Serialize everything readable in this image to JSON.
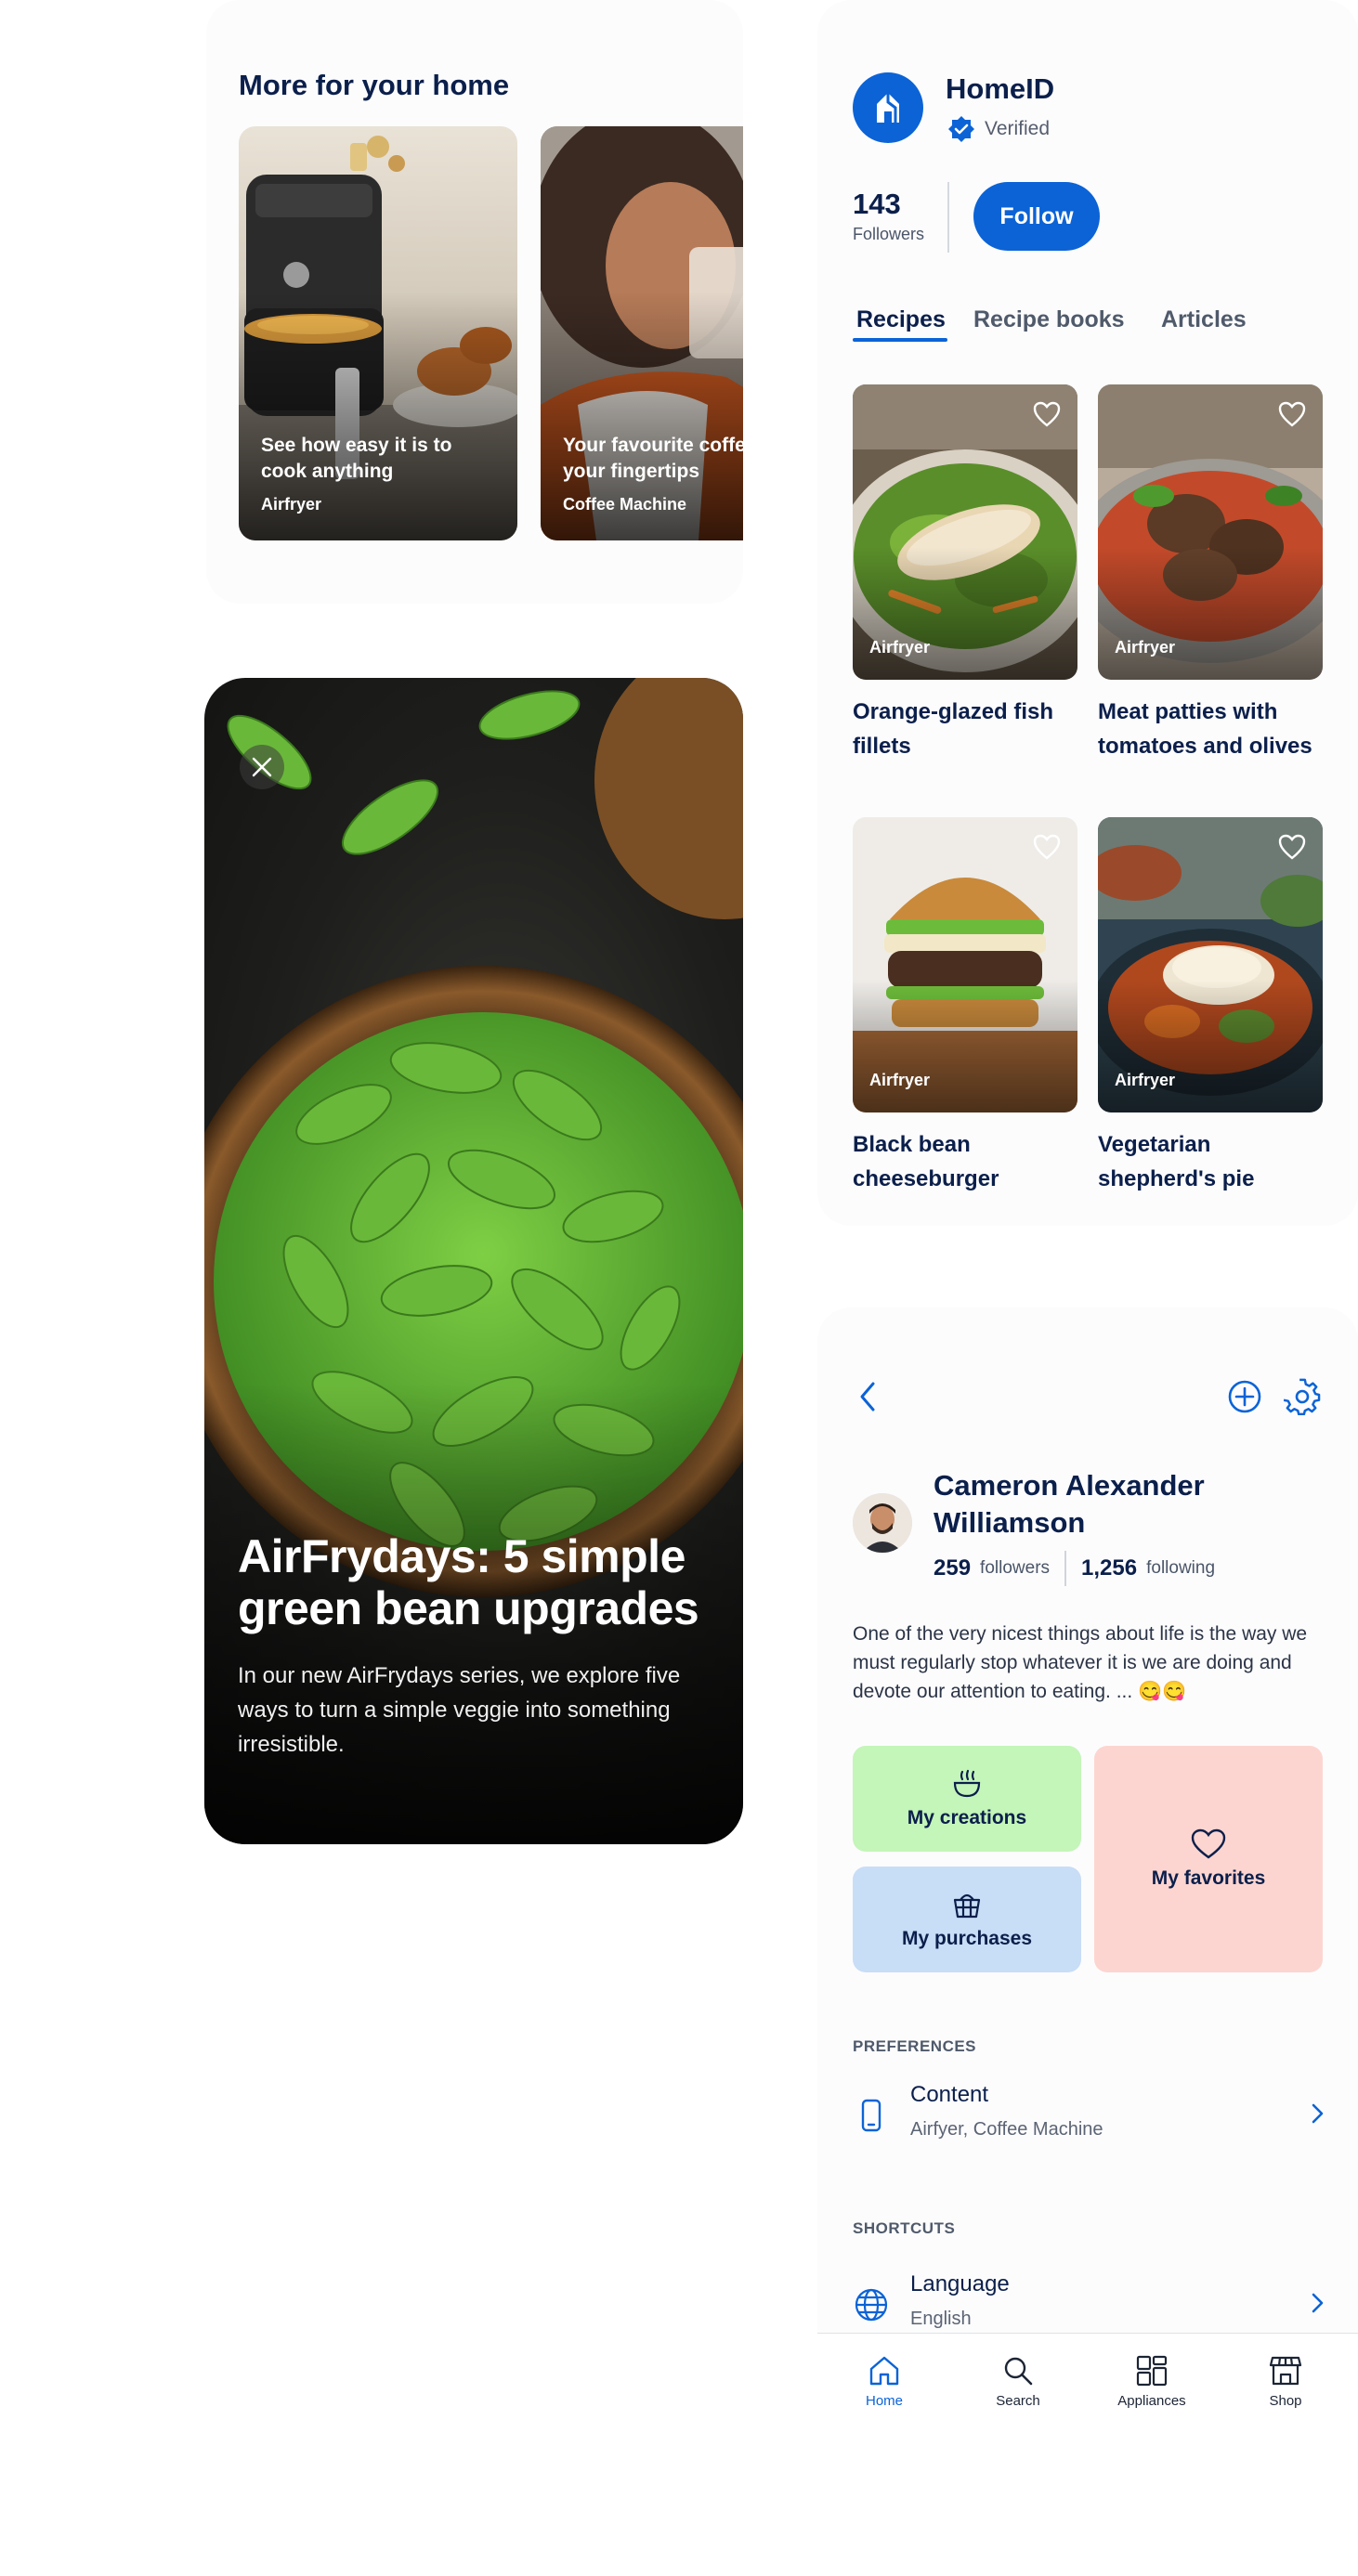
{
  "more_for_home": {
    "title": "More for your home",
    "cards": [
      {
        "title": "See how easy it is to\ncook anything",
        "tag": "Airfryer"
      },
      {
        "title": "Your favourite coffee\nyour fingertips",
        "tag": "Coffee Machine"
      }
    ]
  },
  "article": {
    "title": "AirFrydays: 5 simple green bean upgrades",
    "body": "In our new AirFrydays series, we explore five ways to turn a simple veggie into something irresistible."
  },
  "brand": {
    "name": "HomeID",
    "verified_label": "Verified",
    "followers_count": "143",
    "followers_label": "Followers",
    "follow_label": "Follow",
    "accent": "#0b63d6",
    "tabs": [
      "Recipes",
      "Recipe books",
      "Articles"
    ],
    "recipes": [
      {
        "name": "Orange-glazed fish\nfillets",
        "tag": "Airfryer"
      },
      {
        "name": "Meat patties with\ntomatoes and olives",
        "tag": "Airfryer"
      },
      {
        "name": "Black bean\ncheeseburger",
        "tag": "Airfryer"
      },
      {
        "name": "Vegetarian\nshepherd's pie",
        "tag": "Airfryer"
      }
    ]
  },
  "profile": {
    "name": "Cameron Alexander Williamson",
    "followers_count": "259",
    "followers_label": "followers",
    "following_count": "1,256",
    "following_label": "following",
    "bio": "One of the very nicest things about life is the way we must regularly stop whatever it is we are doing and devote our attention to eating. ... 😋😋",
    "tiles": {
      "creations": "My creations",
      "purchases": "My purchases",
      "favorites": "My favorites"
    },
    "preferences_label": "PREFERENCES",
    "content_title": "Content",
    "content_sub": "Airfyer, Coffee Machine",
    "shortcuts_label": "SHORTCUTS",
    "language_title": "Language",
    "language_sub": "English",
    "tile_colors": {
      "creations": "#c4f5b9",
      "purchases": "#c8ddf6",
      "favorites": "#fdd5d0"
    }
  },
  "nav": {
    "home": "Home",
    "search": "Search",
    "appliances": "Appliances",
    "shop": "Shop"
  }
}
